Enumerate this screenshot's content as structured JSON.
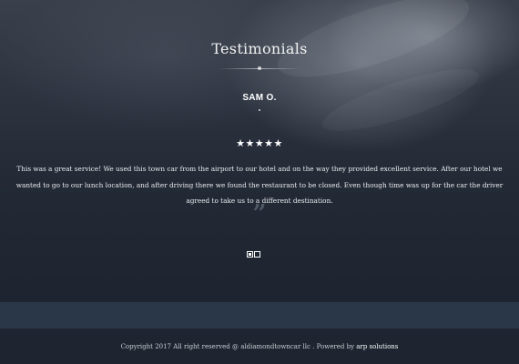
{
  "testimonials": {
    "title": "Testimonials",
    "name": "SAM O.",
    "rating": 5,
    "stars": "★★★★★",
    "quote": "This was a great service! We used this town car from the airport to our hotel and on the way they provided excellent service. After our hotel we wanted to go to our lunch location, and after driving there we found the restaurant to be closed. Even though time was up for the car the driver agreed to take us to a different destination.",
    "quote_icon": "”",
    "pager": {
      "count": 2,
      "active_index": 0
    }
  },
  "footer": {
    "copyright_text": "Copyright 2017 All right reserved @ aldiamondtowncar llc . Powered by ",
    "powered_link": "arp solutions"
  },
  "colors": {
    "footer_band": "#2a3748",
    "footer_bg": "#1e2530",
    "text_light": "#ffffff"
  }
}
